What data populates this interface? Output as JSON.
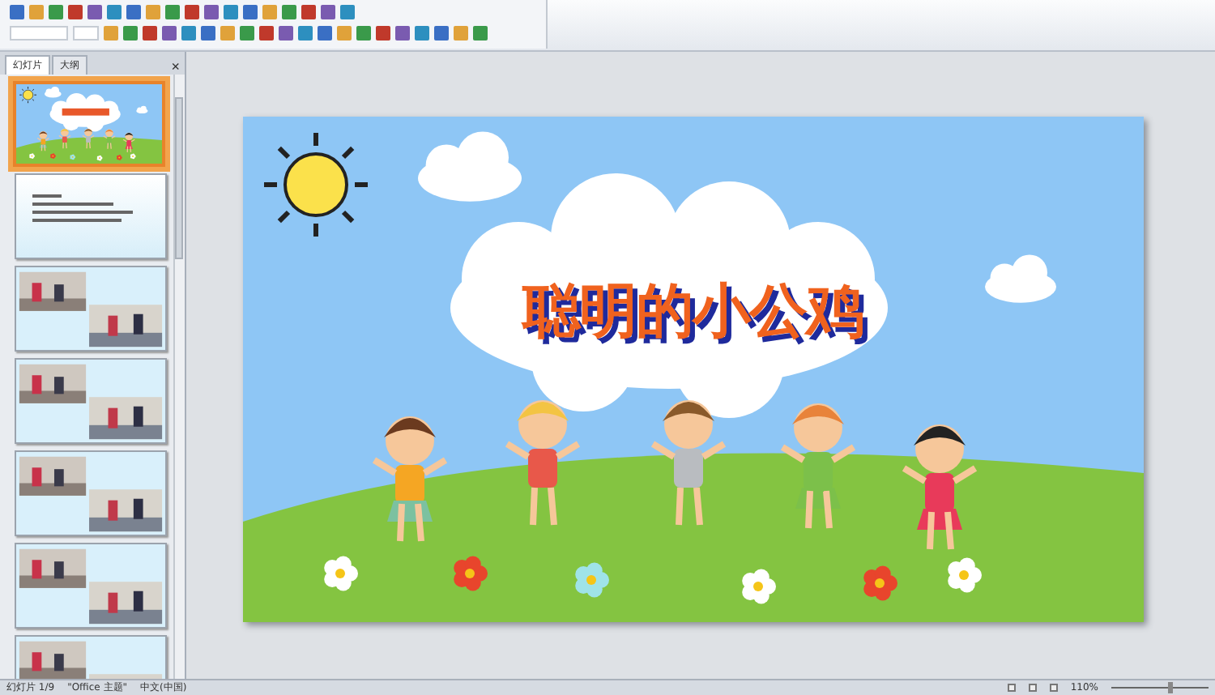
{
  "panel": {
    "tabs": [
      {
        "label": "幻灯片",
        "selected": true
      },
      {
        "label": "大纲",
        "selected": false
      }
    ],
    "close": "×"
  },
  "thumbnails": [
    {
      "kind": "title",
      "selected": true
    },
    {
      "kind": "text",
      "selected": false
    },
    {
      "kind": "photos",
      "selected": false
    },
    {
      "kind": "photos",
      "selected": false
    },
    {
      "kind": "photos",
      "selected": false
    },
    {
      "kind": "photos",
      "selected": false
    },
    {
      "kind": "photos",
      "selected": false
    }
  ],
  "slide": {
    "title": "聪明的小公鸡"
  },
  "status_bar": {
    "items": [
      "幻灯片 1/9",
      "\"Office 主题\"",
      "中文(中国)"
    ],
    "zoom": {
      "reading": "110%",
      "level": 0.6
    }
  }
}
